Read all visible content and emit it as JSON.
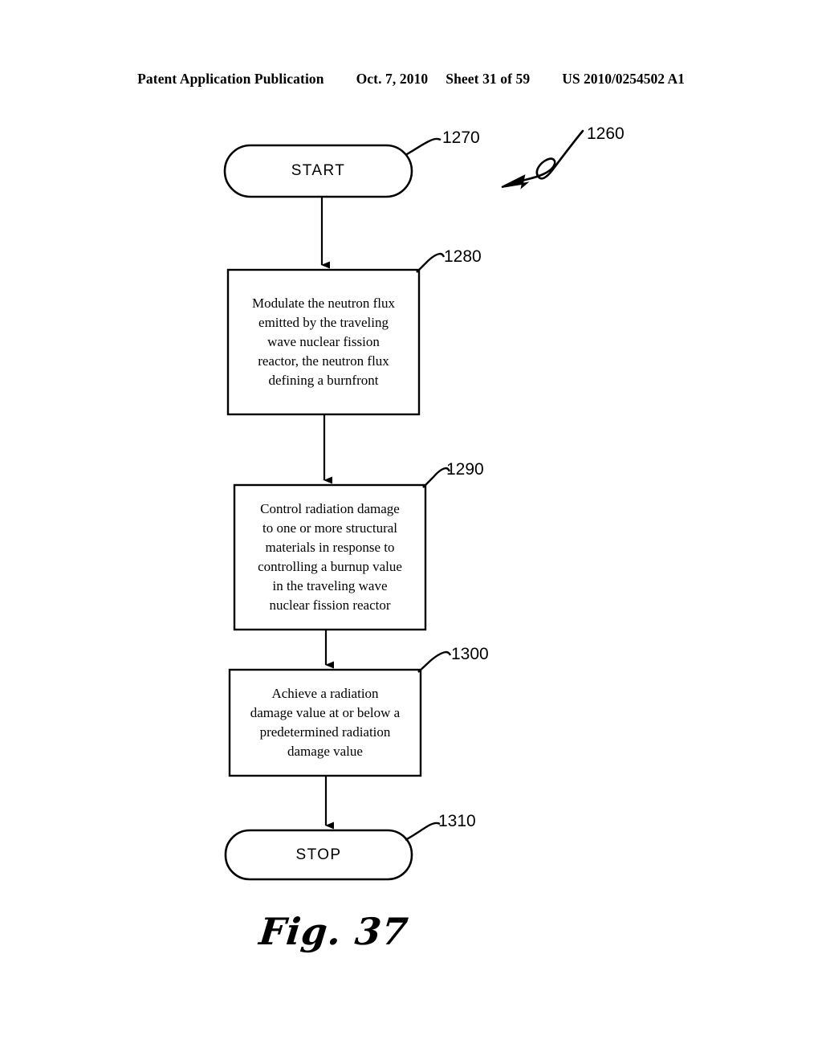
{
  "header": {
    "publication": "Patent Application Publication",
    "date": "Oct. 7, 2010",
    "sheet": "Sheet 31 of 59",
    "patent_number": "US 2010/0254502 A1"
  },
  "figure": {
    "caption": "Fig. 37",
    "diagram_reference": "1260",
    "type": "flowchart"
  },
  "flowchart": {
    "nodes": [
      {
        "id": "start",
        "shape": "terminator",
        "label": "START",
        "ref": "1270"
      },
      {
        "id": "modulate-flux",
        "shape": "process",
        "label": "Modulate the neutron flux emitted by the traveling wave nuclear fission reactor, the neutron flux defining a burnfront",
        "lines": [
          "Modulate the neutron flux",
          "emitted by the traveling",
          "wave nuclear fission",
          "reactor, the neutron flux",
          "defining a burnfront"
        ],
        "ref": "1280"
      },
      {
        "id": "control-radiation-damage",
        "shape": "process",
        "label": "Control radiation damage to one or more structural materials in response to controlling a burnup value in the traveling wave nuclear fission reactor",
        "lines": [
          "Control radiation damage",
          "to one or more structural",
          "materials in response to",
          "controlling a burnup value",
          "in the traveling wave",
          "nuclear fission reactor"
        ],
        "ref": "1290"
      },
      {
        "id": "achieve-damage-value",
        "shape": "process",
        "label": "Achieve a radiation damage value at or below a predetermined radiation damage value",
        "lines": [
          "Achieve a radiation",
          "damage value at or below a",
          "predetermined radiation",
          "damage value"
        ],
        "ref": "1300"
      },
      {
        "id": "stop",
        "shape": "terminator",
        "label": "STOP",
        "ref": "1310"
      }
    ],
    "connectors": [
      {
        "from": "start",
        "to": "modulate-flux",
        "style": "arrow-down"
      },
      {
        "from": "modulate-flux",
        "to": "control-radiation-damage",
        "style": "arrow-down"
      },
      {
        "from": "control-radiation-damage",
        "to": "achieve-damage-value",
        "style": "arrow-down"
      },
      {
        "from": "achieve-damage-value",
        "to": "stop",
        "style": "arrow-down"
      }
    ]
  },
  "colors": {
    "ink": "#000000",
    "page": "#ffffff"
  }
}
